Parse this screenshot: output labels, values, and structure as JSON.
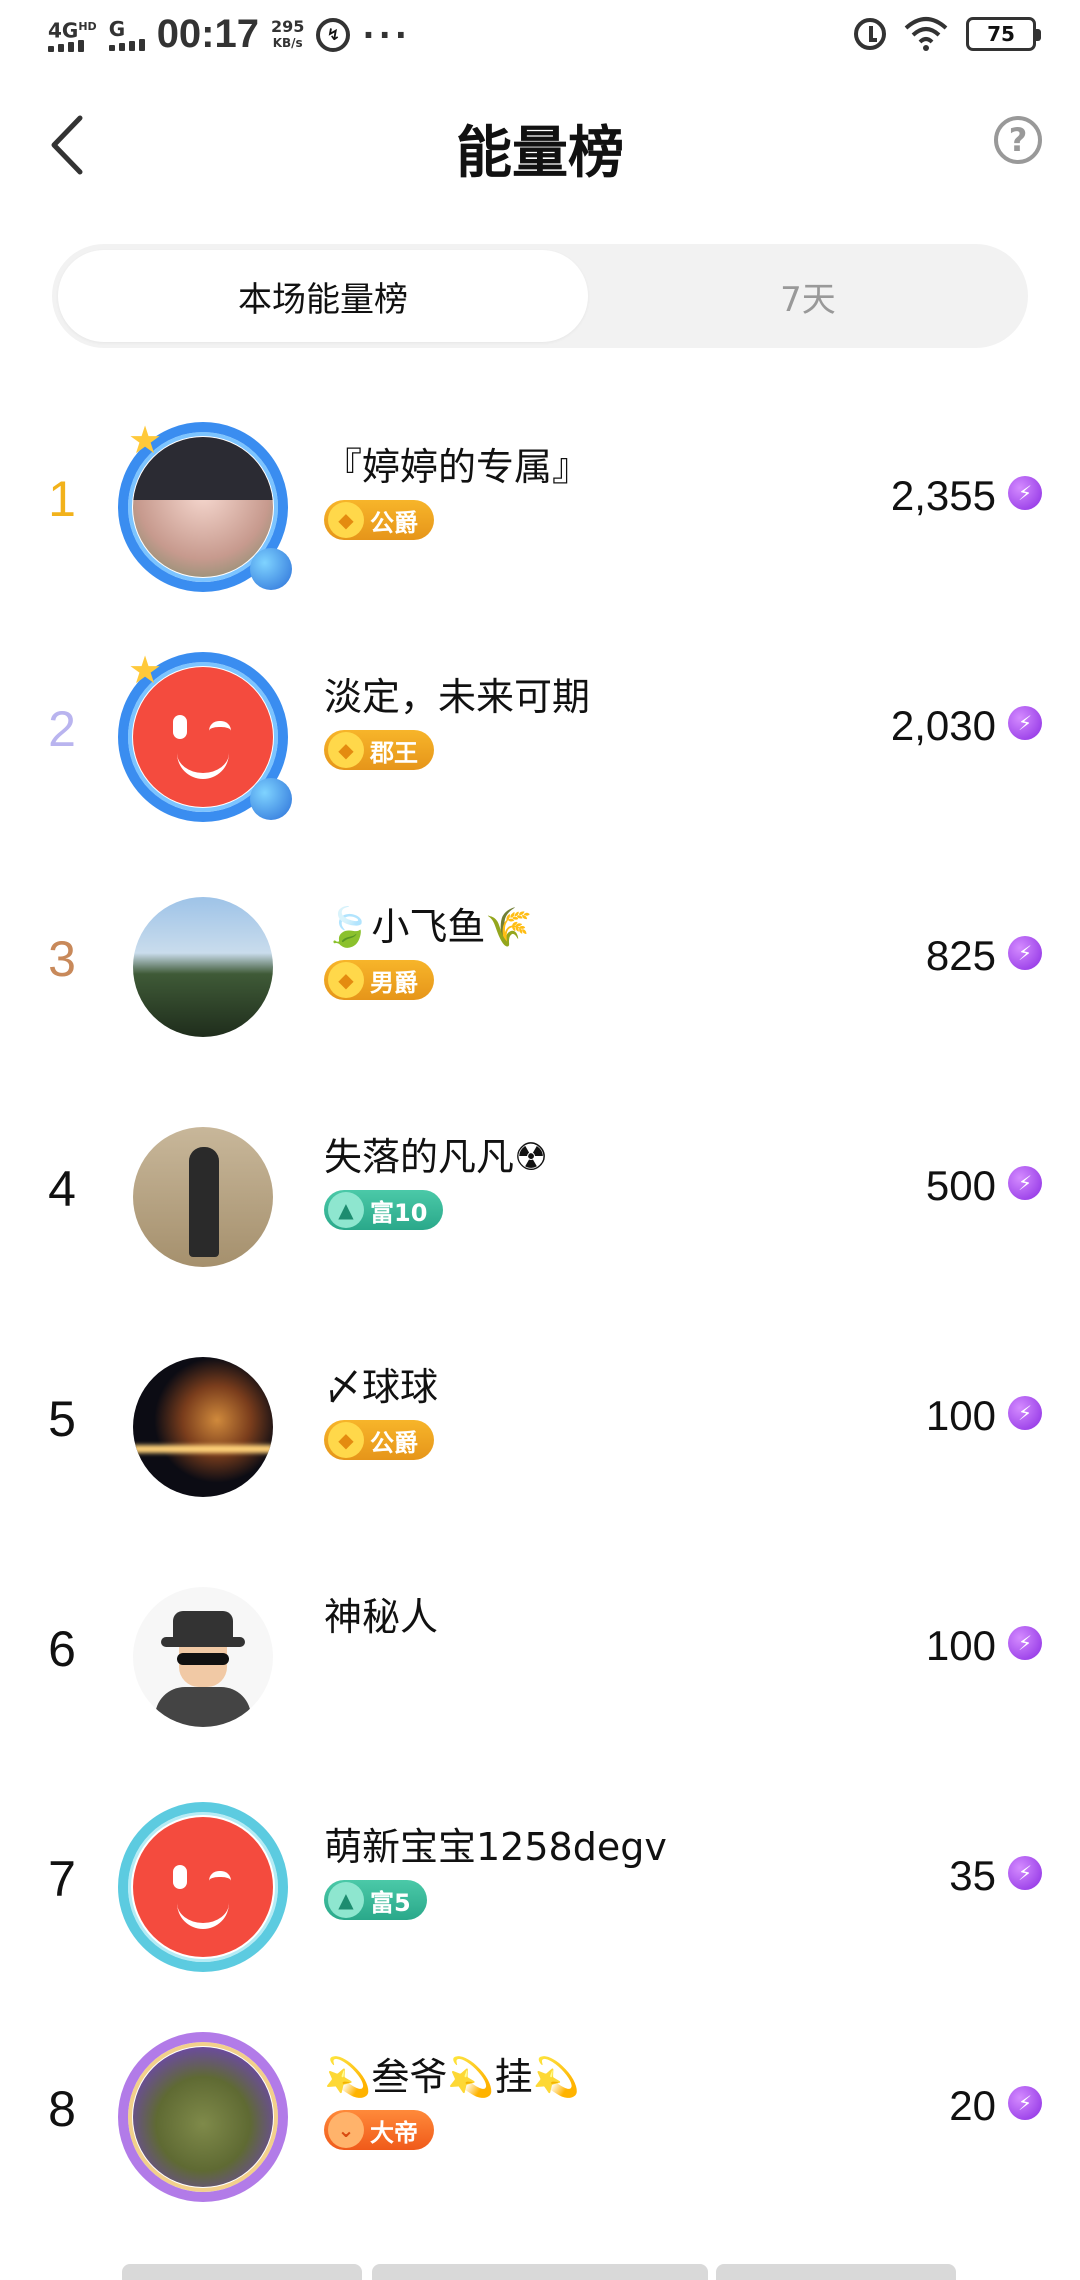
{
  "status_bar": {
    "network": "4G",
    "network_sup": "HD",
    "network2": "G",
    "time": "00:17",
    "speed_value": "295",
    "speed_unit": "KB/s",
    "battery": "75"
  },
  "header": {
    "title": "能量榜",
    "help_label": "?"
  },
  "tabs": [
    {
      "label": "本场能量榜",
      "active": true
    },
    {
      "label": "7天",
      "active": false
    }
  ],
  "rankings": [
    {
      "rank": "1",
      "name": "『婷婷的专属』",
      "badge": "公爵",
      "score": "2,355",
      "rank_color": "#f2b21b"
    },
    {
      "rank": "2",
      "name": "淡定，未来可期",
      "badge": "郡王",
      "score": "2,030",
      "rank_color": "#b9b4ef"
    },
    {
      "rank": "3",
      "name": "🍃小飞鱼🌾",
      "badge": "男爵",
      "score": "825",
      "rank_color": "#c8895a"
    },
    {
      "rank": "4",
      "name": "失落的凡凡☢",
      "badge": "富10",
      "score": "500",
      "rank_color": "#111111"
    },
    {
      "rank": "5",
      "name": "〆球球",
      "badge": "公爵",
      "score": "100",
      "rank_color": "#111111"
    },
    {
      "rank": "6",
      "name": "神秘人",
      "badge": "",
      "score": "100",
      "rank_color": "#111111"
    },
    {
      "rank": "7",
      "name": "萌新宝宝1258degv",
      "badge": "富5",
      "score": "35",
      "rank_color": "#111111"
    },
    {
      "rank": "8",
      "name": "💫叁爷💫挂💫",
      "badge": "大帝",
      "score": "20",
      "rank_color": "#111111"
    }
  ],
  "icons": {
    "energy": "energy-bolt-icon",
    "back": "back-arrow-icon",
    "help": "help-icon"
  }
}
